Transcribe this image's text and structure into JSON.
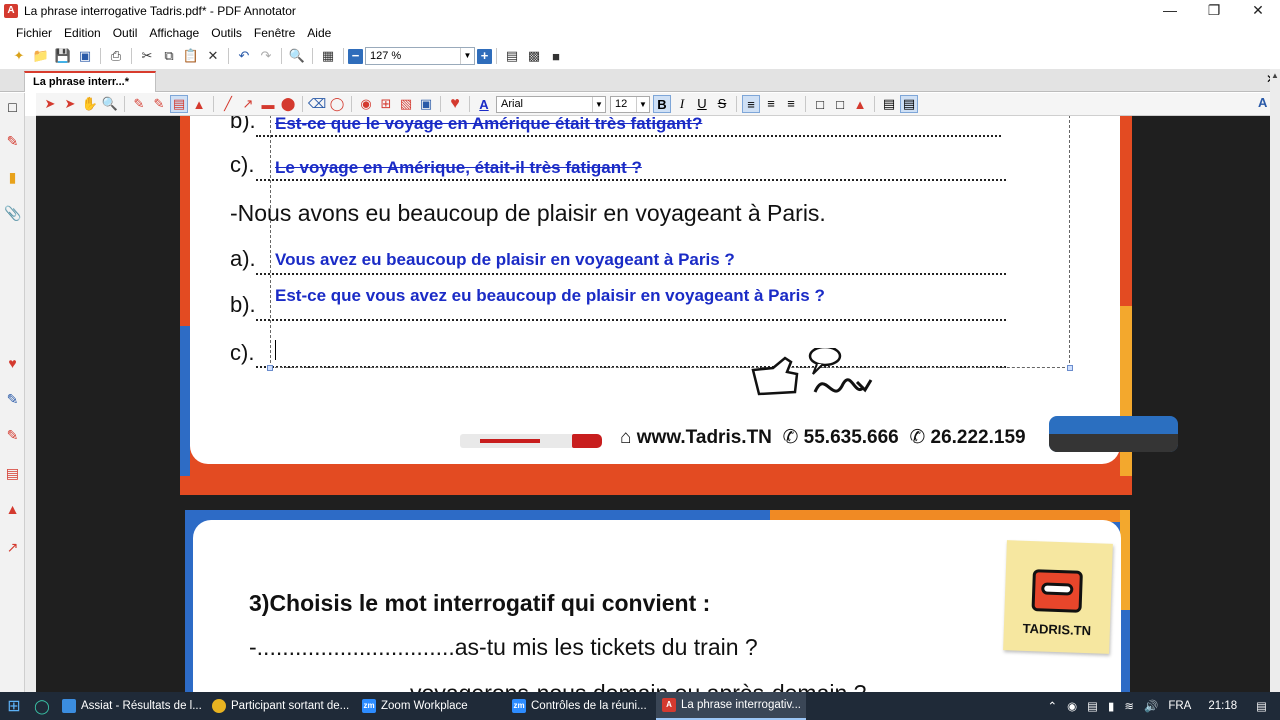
{
  "window": {
    "title": "La phrase interrogative Tadris.pdf* - PDF Annotator",
    "app_icon": "pdf-annotator-icon"
  },
  "menu": [
    "Fichier",
    "Edition",
    "Outil",
    "Affichage",
    "Outils",
    "Fenêtre",
    "Aide"
  ],
  "toolbar": {
    "zoom_value": "127 %"
  },
  "tab": {
    "label": "La phrase interr...*"
  },
  "annotation_toolbar": {
    "font_name": "Arial",
    "font_size": "12",
    "bold": "B",
    "italic": "I",
    "underline": "U",
    "strike": "S"
  },
  "page1": {
    "rows": [
      {
        "label": "b).",
        "answer": "Est-ce que le voyage en Amérique était très fatigant?",
        "strike": true
      },
      {
        "label": "c).",
        "answer": "Le voyage en Amérique, était-il très fatigant ?",
        "strike": true
      }
    ],
    "sentence": "-Nous avons eu beaucoup de plaisir en voyageant à Paris.",
    "rows2": [
      {
        "label": "a).",
        "answer": "Vous avez eu beaucoup de plaisir en voyageant à Paris ?"
      },
      {
        "label": "b).",
        "answer": "Est-ce que vous avez eu beaucoup de plaisir en voyageant à Paris ?"
      },
      {
        "label": "c).",
        "answer": ""
      }
    ],
    "footer": {
      "website": "www.Tadris.TN",
      "phone1": "55.635.666",
      "phone2": "26.222.159"
    }
  },
  "page2": {
    "heading": "3)Choisis le mot interrogatif qui convient :",
    "q1": "-...............................as-tu mis les tickets du train ?",
    "q2": "-........................voyagerons-nous demain ou après-demain ?",
    "logo_text": "TADRIS.TN"
  },
  "taskbar": {
    "apps": [
      {
        "label": "Assiat - Résultats de l...",
        "icon_color": "#3b8de0"
      },
      {
        "label": "Participant sortant de...",
        "icon_color": "#e8b321"
      },
      {
        "label": "Zoom Workplace",
        "icon_color": "#2d8cff"
      },
      {
        "label": "Contrôles de la réuni...",
        "icon_color": "#2d8cff"
      },
      {
        "label": "La phrase interrogativ...",
        "icon_color": "#d43a2f"
      }
    ],
    "language": "FRA",
    "time": "21:18"
  }
}
